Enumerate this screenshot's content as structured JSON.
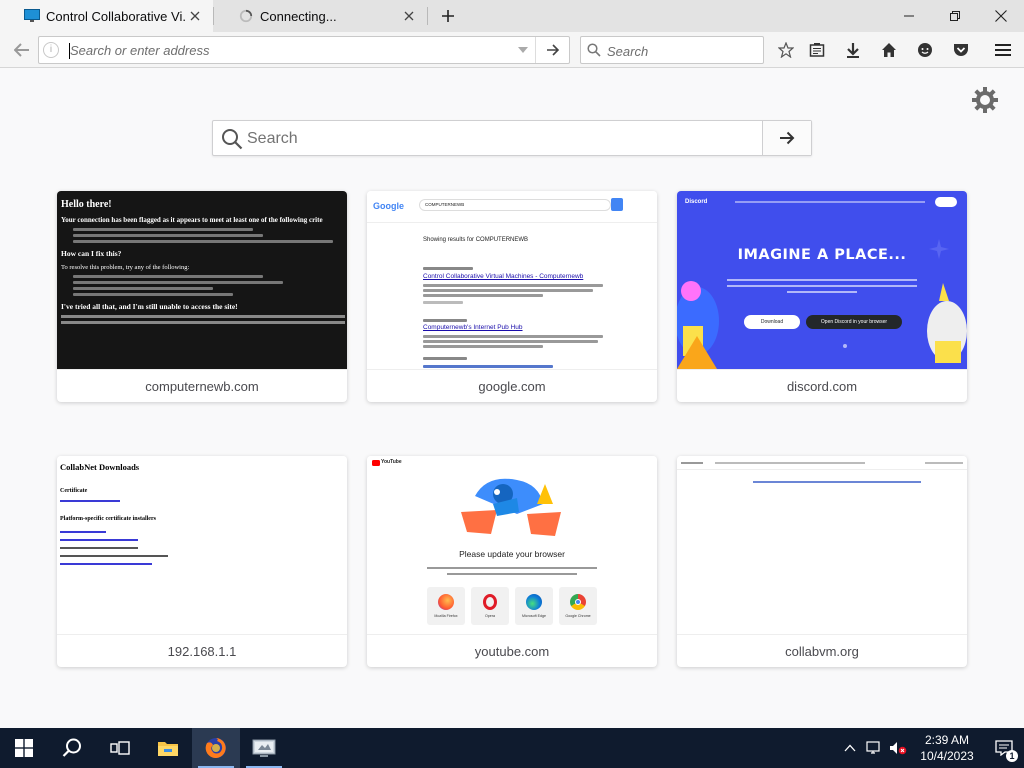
{
  "window": {
    "tabs": [
      {
        "title": "Control Collaborative Vi...",
        "favicon": "monitor-favicon",
        "active": true
      },
      {
        "title": "Connecting...",
        "favicon": "loading-spinner",
        "active": false
      }
    ],
    "new_tab_label": "+",
    "controls": [
      "minimize",
      "restore",
      "close"
    ]
  },
  "navbar": {
    "address_placeholder": "Search or enter address",
    "address_value": "",
    "search_placeholder": "Search",
    "icons": [
      "back-icon",
      "site-info-icon",
      "go-arrow-icon",
      "bookmark-star-icon",
      "reading-list-icon",
      "download-icon",
      "home-icon",
      "chat-icon",
      "pocket-icon",
      "menu-icon"
    ]
  },
  "newtab": {
    "search_placeholder": "Search",
    "settings_icon": "gear-icon",
    "top_sites": [
      {
        "label": "computernewb.com",
        "thumb": "computernewb"
      },
      {
        "label": "google.com",
        "thumb": "google"
      },
      {
        "label": "discord.com",
        "thumb": "discord"
      },
      {
        "label": "192.168.1.1",
        "thumb": "collabnet"
      },
      {
        "label": "youtube.com",
        "thumb": "youtube"
      },
      {
        "label": "collabvm.org",
        "thumb": "collabvm"
      }
    ],
    "thumb_text": {
      "computernewb_heading": "Hello there!",
      "computernewb_sub1": "Your connection has been flagged as it appears to meet at least one of the following crite",
      "computernewb_sub2": "How can I fix this?",
      "computernewb_sub3": "To resolve this problem, try any of the following:",
      "computernewb_sub4": "I've tried all that, and I'm still unable to access the site!",
      "google_logo": "Google",
      "google_query": "COMPUTERNEWB",
      "google_results_for": "Showing results for COMPUTERNEWB",
      "google_result1": "Control Collaborative Virtual Machines - Computernewb",
      "google_result2": "Computernewb's Internet Pub Hub",
      "discord_brand": "Discord",
      "discord_headline": "IMAGINE A PLACE...",
      "discord_download": "Download",
      "discord_open": "Open Discord in your browser",
      "collabnet_heading": "CollabNet Downloads",
      "collabnet_cert": "Certificate",
      "collabnet_platform": "Platform-specific certificate installers",
      "youtube_brand": "YouTube",
      "youtube_update": "Please update your browser",
      "youtube_browsers": [
        "Mozilla Firefox",
        "Opera",
        "Microsoft Edge",
        "Google Chrome"
      ]
    }
  },
  "taskbar": {
    "apps": [
      "windows-start-icon",
      "search-icon",
      "task-view-icon",
      "file-explorer-icon",
      "firefox-icon",
      "vm-app-icon"
    ],
    "clock_time": "2:39 AM",
    "clock_date": "10/4/2023",
    "notification_count": "1"
  },
  "colors": {
    "tabstrip": "#e3e3e3",
    "toolbar": "#f5f5f5",
    "page_bg": "#f9f9fa",
    "discord_blurple": "#404eed",
    "taskbar": "#0f1b2e"
  }
}
